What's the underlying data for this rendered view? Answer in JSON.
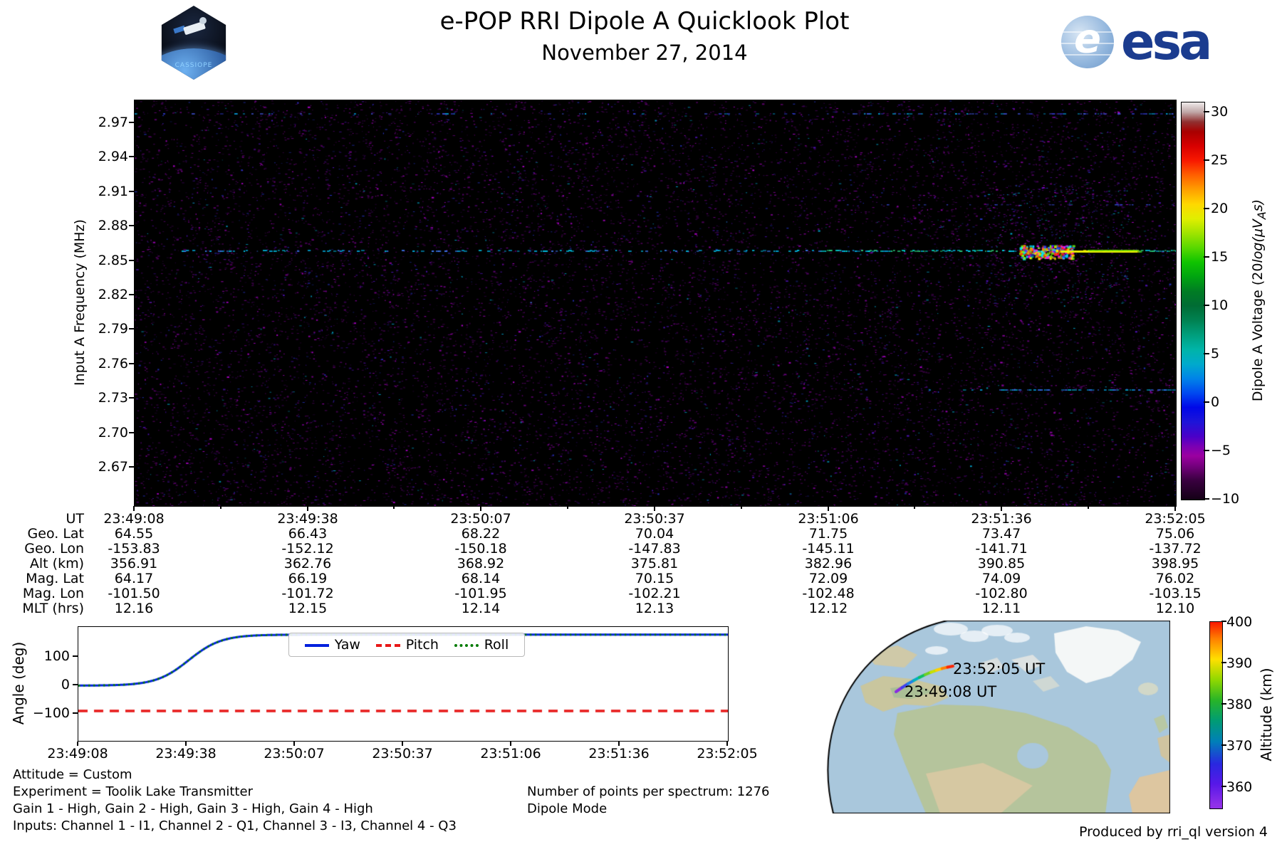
{
  "header": {
    "title": "e-POP RRI Dipole A Quicklook Plot",
    "subtitle": "November 27, 2014",
    "mission_patch": "CASSIOPE",
    "esa_globe_letter": "e",
    "esa_wordmark": "esa"
  },
  "colors": {
    "yaw_blue": "#0020dd",
    "pitch_red": "#e81818",
    "roll_green": "#007a00",
    "esa_blue": "#1b3c8f",
    "noise_magenta": "#8a00a0",
    "ocean_blue": "#a9c7dc",
    "land_green": "#b5c49c",
    "land_tan": "#d6c8a2"
  },
  "time_ticks": [
    "23:49:08",
    "23:49:38",
    "23:50:07",
    "23:50:37",
    "23:51:06",
    "23:51:36",
    "23:52:05"
  ],
  "spectrogram": {
    "ylabel": "Input A Frequency (MHz)",
    "y_ticks": [
      "2.97",
      "2.94",
      "2.91",
      "2.88",
      "2.85",
      "2.82",
      "2.79",
      "2.76",
      "2.73",
      "2.70",
      "2.67"
    ],
    "colorbar": {
      "label_prefix": "Dipole A Voltage (20",
      "label_math": "log(μV",
      "label_sub": "A",
      "label_suffix": "s)",
      "ticks": [
        "30",
        "25",
        "20",
        "15",
        "10",
        "5",
        "0",
        "−5",
        "−10"
      ]
    }
  },
  "ephemeris": {
    "row_labels": [
      "UT",
      "Geo. Lat",
      "Geo. Lon",
      "Alt (km)",
      "Mag. Lat",
      "Mag. Lon",
      "MLT (hrs)"
    ],
    "geo_lat": [
      "64.55",
      "66.43",
      "68.22",
      "70.04",
      "71.75",
      "73.47",
      "75.06"
    ],
    "geo_lon": [
      "-153.83",
      "-152.12",
      "-150.18",
      "-147.83",
      "-145.11",
      "-141.71",
      "-137.72"
    ],
    "alt_km": [
      "356.91",
      "362.76",
      "368.92",
      "375.81",
      "382.96",
      "390.85",
      "398.95"
    ],
    "mag_lat": [
      "64.17",
      "66.19",
      "68.14",
      "70.15",
      "72.09",
      "74.09",
      "76.02"
    ],
    "mag_lon": [
      "-101.50",
      "-101.72",
      "-101.95",
      "-102.21",
      "-102.48",
      "-102.80",
      "-103.15"
    ],
    "mlt_hrs": [
      "12.16",
      "12.15",
      "12.14",
      "12.13",
      "12.12",
      "12.11",
      "12.10"
    ]
  },
  "attitude": {
    "ylabel": "Angle (deg)",
    "y_ticks": [
      "100",
      "0",
      "−100"
    ],
    "legend": [
      "Yaw",
      "Pitch",
      "Roll"
    ]
  },
  "map": {
    "end_time_label": "23:52:05 UT",
    "start_time_label": "23:49:08 UT",
    "colorbar": {
      "label": "Altitude (km)",
      "ticks": [
        "400",
        "390",
        "380",
        "370",
        "360"
      ]
    }
  },
  "info": {
    "attitude": "Attitude = Custom",
    "experiment": "Experiment = Toolik Lake Transmitter",
    "gains": "Gain 1 - High, Gain 2 - High, Gain 3 - High, Gain 4 - High",
    "inputs": "Inputs: Channel 1 - I1, Channel 2 - Q1, Channel 3 - I3, Channel 4 - Q3",
    "points": "Number of points per spectrum: 1276",
    "mode": "Dipole Mode"
  },
  "footer": "Produced by rri_ql version 4",
  "chart_data": [
    {
      "type": "heatmap",
      "title": "e-POP RRI Dipole A Quicklook Plot",
      "subtitle": "November 27, 2014",
      "xlabel": "UT",
      "ylabel": "Input A Frequency (MHz)",
      "x_ticks": [
        "23:49:08",
        "23:49:38",
        "23:50:07",
        "23:50:37",
        "23:51:06",
        "23:51:36",
        "23:52:05"
      ],
      "y_ticks": [
        2.97,
        2.94,
        2.91,
        2.88,
        2.85,
        2.82,
        2.79,
        2.76,
        2.73,
        2.7,
        2.67
      ],
      "ylim": [
        2.64,
        2.99
      ],
      "colorbar_label": "Dipole A Voltage (20log(μV_As)",
      "colorbar_ticks": [
        30,
        25,
        20,
        15,
        10,
        5,
        0,
        -5,
        -10
      ],
      "clim": [
        -10,
        31
      ],
      "background": "black with sparse impulsive magenta/purple noise speckle near -10 to -4 dB, occasional blue/cyan pixels",
      "features": [
        {
          "kind": "narrowband line",
          "freq_MHz": 2.858,
          "from": "23:49:15",
          "to": "23:52:05",
          "level_dB": "0-8 weak cyan, 15-31 strong after ~23:51:30",
          "note": "Toolik Lake transmitter; bright multicolor burst near 23:51:40 then yellow-green streak to end"
        },
        {
          "kind": "narrowband line",
          "freq_MHz": 2.74,
          "from": "23:51:25",
          "to": "23:52:05",
          "level_dB": "0-5 cyan"
        },
        {
          "kind": "narrowband line",
          "freq_MHz": 2.977,
          "from": "23:49:08",
          "to": "23:52:05",
          "level_dB": "-5 to 0 intermittent blue"
        }
      ],
      "legend_position": "right colorbar"
    },
    {
      "type": "table",
      "columns": [
        "23:49:08",
        "23:49:38",
        "23:50:07",
        "23:50:37",
        "23:51:06",
        "23:51:36",
        "23:52:05"
      ],
      "rows": [
        {
          "label": "Geo. Lat",
          "values": [
            64.55,
            66.43,
            68.22,
            70.04,
            71.75,
            73.47,
            75.06
          ]
        },
        {
          "label": "Geo. Lon",
          "values": [
            -153.83,
            -152.12,
            -150.18,
            -147.83,
            -145.11,
            -141.71,
            -137.72
          ]
        },
        {
          "label": "Alt (km)",
          "values": [
            356.91,
            362.76,
            368.92,
            375.81,
            382.96,
            390.85,
            398.95
          ]
        },
        {
          "label": "Mag. Lat",
          "values": [
            64.17,
            66.19,
            68.14,
            70.15,
            72.09,
            74.09,
            76.02
          ]
        },
        {
          "label": "Mag. Lon",
          "values": [
            -101.5,
            -101.72,
            -101.95,
            -102.21,
            -102.48,
            -102.8,
            -103.15
          ]
        },
        {
          "label": "MLT (hrs)",
          "values": [
            12.16,
            12.15,
            12.14,
            12.13,
            12.12,
            12.11,
            12.1
          ]
        }
      ]
    },
    {
      "type": "line",
      "ylabel": "Angle (deg)",
      "ylim": [
        -195,
        205
      ],
      "y_ticks": [
        100,
        0,
        -100
      ],
      "x_ticks": [
        "23:49:08",
        "23:49:38",
        "23:50:07",
        "23:50:37",
        "23:51:06",
        "23:51:36",
        "23:52:05"
      ],
      "legend_position": "top center inside",
      "series": [
        {
          "name": "Yaw",
          "color": "#0020dd",
          "style": "solid",
          "points_t_sec_deg": [
            [
              0,
              0
            ],
            [
              20,
              3
            ],
            [
              28,
              10
            ],
            [
              32,
              25
            ],
            [
              35,
              60
            ],
            [
              38,
              115
            ],
            [
              41,
              155
            ],
            [
              45,
              170
            ],
            [
              50,
              175
            ],
            [
              60,
              177
            ],
            [
              177,
              178
            ]
          ]
        },
        {
          "name": "Pitch",
          "color": "#e81818",
          "style": "dashed",
          "points_t_sec_deg": [
            [
              0,
              -90
            ],
            [
              177,
              -90
            ]
          ]
        },
        {
          "name": "Roll",
          "color": "#007a00",
          "style": "dotted",
          "note": "overlays Yaw exactly",
          "points_t_sec_deg": [
            [
              0,
              0
            ],
            [
              20,
              3
            ],
            [
              28,
              10
            ],
            [
              32,
              25
            ],
            [
              35,
              60
            ],
            [
              38,
              115
            ],
            [
              41,
              155
            ],
            [
              45,
              170
            ],
            [
              50,
              175
            ],
            [
              60,
              177
            ],
            [
              177,
              178
            ]
          ]
        }
      ]
    },
    {
      "type": "map",
      "projection": "orthographic globe view of North America / Arctic / Greenland / North Atlantic",
      "track": {
        "colored_by": "altitude",
        "start": {
          "label": "23:49:08 UT",
          "geo_lat": 64.55,
          "geo_lon": -153.83,
          "alt_km": 356.91
        },
        "end": {
          "label": "23:52:05 UT",
          "geo_lat": 75.06,
          "geo_lon": -137.72,
          "alt_km": 398.95
        }
      },
      "colorbar_label": "Altitude (km)",
      "colorbar_ticks": [
        400,
        390,
        380,
        370,
        360
      ],
      "colorbar_lim": [
        356,
        400
      ]
    }
  ]
}
